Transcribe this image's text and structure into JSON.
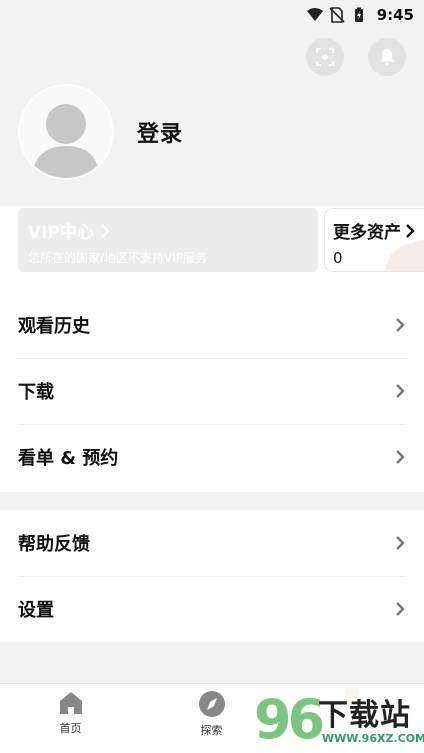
{
  "status_bar": {
    "time": "9:45"
  },
  "profile": {
    "login_label": "登录"
  },
  "vip_card": {
    "title": "VIP中心",
    "subtitle": "您所在的国家/地区不支持VIP服务"
  },
  "assets_card": {
    "title": "更多资产",
    "value": "0"
  },
  "menu_group1": [
    {
      "label": "观看历史"
    },
    {
      "label": "下载"
    },
    {
      "label": "看单 & 预约"
    }
  ],
  "menu_group2": [
    {
      "label": "帮助反馈"
    },
    {
      "label": "设置"
    }
  ],
  "bottom_nav": [
    {
      "label": "首页",
      "icon": "home-icon"
    },
    {
      "label": "探索",
      "icon": "compass-icon"
    }
  ],
  "watermark": {
    "number": "96",
    "text": "下载站",
    "url": "WWW.96XZ.COM"
  },
  "colors": {
    "accent_green": "#7bc67e",
    "badge_orange": "#ff6a2a"
  }
}
